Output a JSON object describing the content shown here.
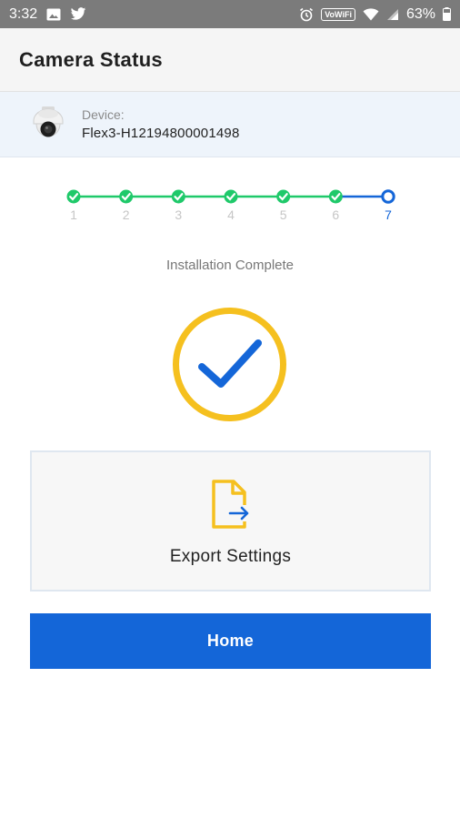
{
  "status_bar": {
    "time": "3:32",
    "vowifi": "VoWiFi",
    "battery": "63%"
  },
  "header": {
    "title": "Camera Status"
  },
  "device": {
    "label": "Device:",
    "id": "Flex3-H12194800001498"
  },
  "stepper": {
    "steps": [
      "1",
      "2",
      "3",
      "4",
      "5",
      "6",
      "7"
    ],
    "completed": 6,
    "current": 7,
    "complete_color": "#1fc96a",
    "current_color": "#1466d8"
  },
  "install_status": "Installation Complete",
  "export": {
    "label": "Export Settings"
  },
  "home": {
    "label": "Home"
  },
  "colors": {
    "accent_blue": "#1466d8",
    "ring_yellow": "#f5c01f"
  }
}
